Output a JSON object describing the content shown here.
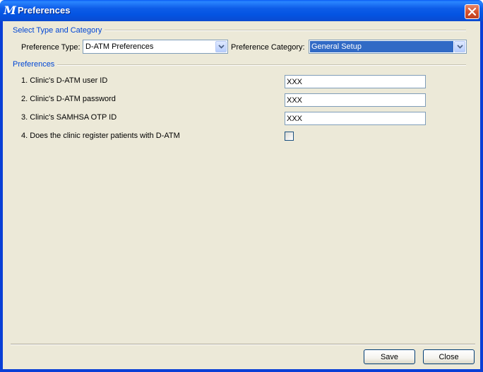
{
  "window": {
    "title": "Preferences",
    "app_icon_glyph": "M",
    "accent": "#0a5cf5"
  },
  "type_category": {
    "group_label": "Select Type and Category",
    "preference_type_label": "Preference Type:",
    "preference_type_value": "D-ATM Preferences",
    "preference_category_label": "Preference Category:",
    "preference_category_value": "General Setup"
  },
  "preferences": {
    "group_label": "Preferences",
    "items": [
      {
        "label": "1. Clinic's D-ATM user ID",
        "value": "XXX"
      },
      {
        "label": "2. Clinic's D-ATM password",
        "value": "XXX"
      },
      {
        "label": "3. Clinic's SAMHSA OTP ID",
        "value": "XXX"
      },
      {
        "label": "4. Does the clinic register patients with D-ATM",
        "checked": false
      }
    ]
  },
  "buttons": {
    "save": "Save",
    "close": "Close"
  }
}
